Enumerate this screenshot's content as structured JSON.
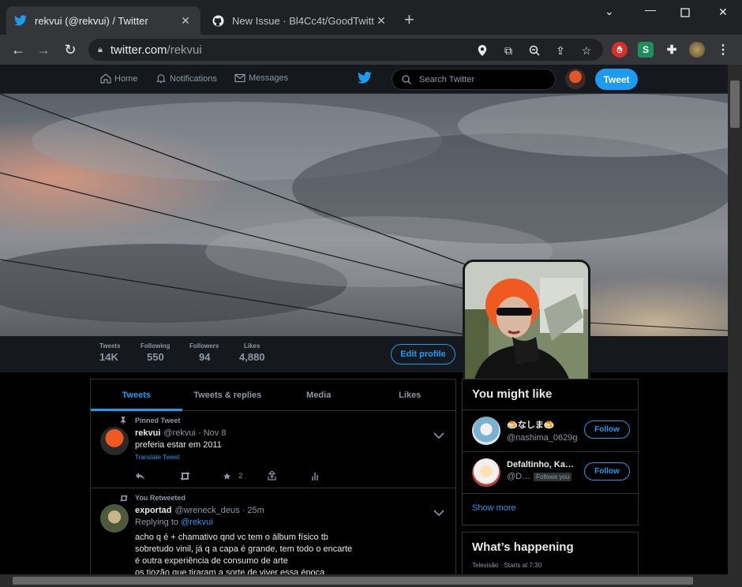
{
  "browser": {
    "tabs": [
      {
        "title": "rekvui (@rekvui) / Twitter",
        "active": true
      },
      {
        "title": "New Issue · Bl4Cc4t/GoodTwitter2",
        "active": false
      }
    ],
    "url_host": "twitter.com",
    "url_path": "/rekvui"
  },
  "nav": {
    "home": "Home",
    "notifications": "Notifications",
    "messages": "Messages",
    "search_placeholder": "Search Twitter",
    "tweet_button": "Tweet"
  },
  "profile": {
    "stats": [
      {
        "label": "Tweets",
        "value": "14K"
      },
      {
        "label": "Following",
        "value": "550"
      },
      {
        "label": "Followers",
        "value": "94"
      },
      {
        "label": "Likes",
        "value": "4,880"
      }
    ],
    "edit_button": "Edit profile"
  },
  "timeline": {
    "tabs": [
      "Tweets",
      "Tweets & replies",
      "Media",
      "Likes"
    ],
    "tweets": [
      {
        "context": "Pinned Tweet",
        "name": "rekvui",
        "meta": "@rekvui · Nov 8",
        "text": "preferia estar em 2011",
        "translate": "Translate Tweet",
        "likes": "2"
      },
      {
        "context": "You Retweeted",
        "name": "exportad",
        "meta": "@wreneck_deus · 25m",
        "replying_prefix": "Replying to",
        "replying_handle": "@rekvui",
        "lines": [
          "acho q é + chamativo qnd vc tem o álbum físico tb",
          "sobretudo vinil, já q a capa é grande, tem todo o encarte",
          "é outra experiência de consumo de arte",
          "os tiozão que tiraram a sorte de viver essa época"
        ]
      }
    ]
  },
  "sidebar": {
    "title": "You might like",
    "suggestions": [
      {
        "name": "🍮なしま🍮",
        "handle": "@nashima_0629g",
        "follow": "Follow",
        "badge": ""
      },
      {
        "name": "Defaltinho, Ka…",
        "handle": "@D…",
        "follow": "Follow",
        "badge": "Follows you"
      }
    ],
    "show_more": "Show more",
    "happening_title": "What’s happening",
    "happening_meta": "Televisão · Starts at 7:30"
  }
}
